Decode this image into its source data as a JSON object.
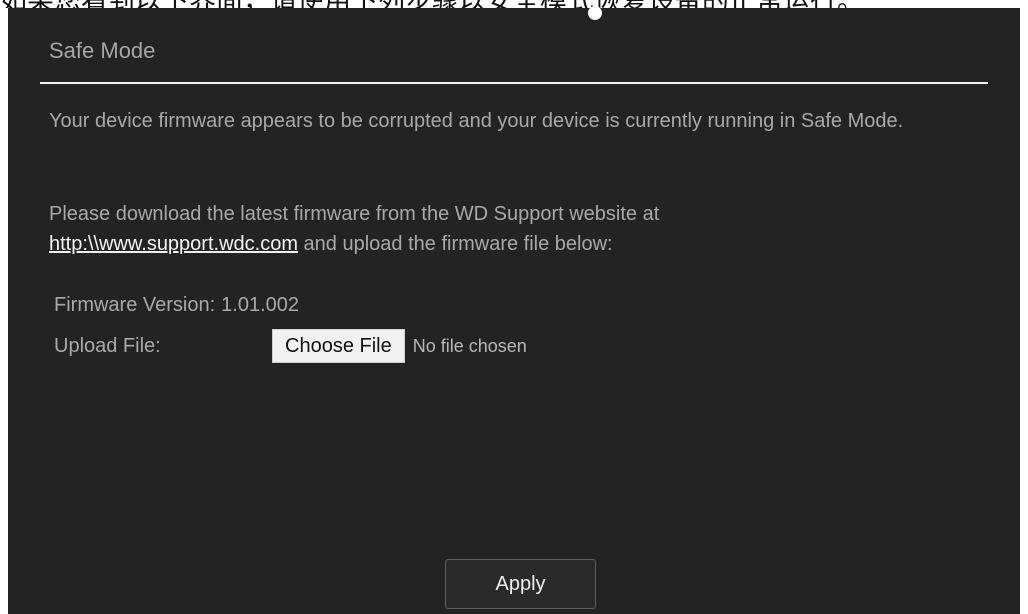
{
  "header": {
    "caption": "如果您看到以下界面，请使用下列步骤以安全模式恢复设备的正常运行。"
  },
  "dialog": {
    "title": "Safe Mode",
    "message_line1": "Your device firmware appears to be corrupted and your device is currently running in Safe Mode.",
    "message_line2_before": "Please download the latest firmware from the WD Support website at",
    "support_link": "http:\\\\www.support.wdc.com",
    "message_line2_after": "and upload the firmware file below:"
  },
  "firmware": {
    "version_label": "Firmware Version:",
    "version_value": "1.01.002"
  },
  "upload": {
    "label": "Upload File:",
    "button_label": "Choose File",
    "status": "No file chosen"
  },
  "actions": {
    "apply_label": "Apply"
  },
  "colors": {
    "background": "#232323",
    "text": "#a9a9a9",
    "divider": "#f2f2f2",
    "link": "#f2f2f2"
  }
}
